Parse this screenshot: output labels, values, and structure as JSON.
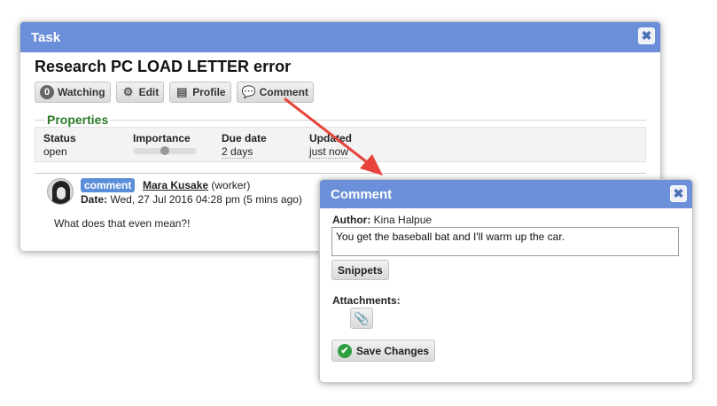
{
  "task_dialog": {
    "title": "Task",
    "close_glyph": "✖",
    "heading": "Research PC LOAD LETTER error",
    "toolbar": {
      "watching_count": "0",
      "watching_label": "Watching",
      "edit_label": "Edit",
      "profile_label": "Profile",
      "comment_label": "Comment"
    },
    "properties": {
      "legend": "Properties",
      "status": {
        "label": "Status",
        "value": "open"
      },
      "importance": {
        "label": "Importance"
      },
      "due_date": {
        "label": "Due date",
        "value": "2 days"
      },
      "updated": {
        "label": "Updated",
        "value": "just now"
      }
    },
    "comment": {
      "tag": "comment",
      "author": "Mara Kusake",
      "role": "(worker)",
      "date_label": "Date:",
      "date_value": "Wed, 27 Jul 2016 04:28 pm (5 mins ago)",
      "body": "What does that even mean?!"
    }
  },
  "comment_dialog": {
    "title": "Comment",
    "close_glyph": "✖",
    "author_label": "Author:",
    "author_name": "Kina Halpue",
    "text_value": "You get the baseball bat and I'll warm up the car.",
    "snippets_label": "Snippets",
    "attachments_label": "Attachments:",
    "save_label": "Save Changes"
  },
  "colors": {
    "titlebar": "#6b8fd8",
    "properties_legend": "#2a7b2a",
    "comment_tag": "#5b8ed8",
    "arrow": "#e8433a",
    "save_check": "#2ea043"
  },
  "icons": [
    "eye-count-badge",
    "gear-icon",
    "profile-card-icon",
    "speech-bubble-icon",
    "paperclip-icon",
    "check-circle-icon",
    "close-icon",
    "arrow-annotation"
  ]
}
